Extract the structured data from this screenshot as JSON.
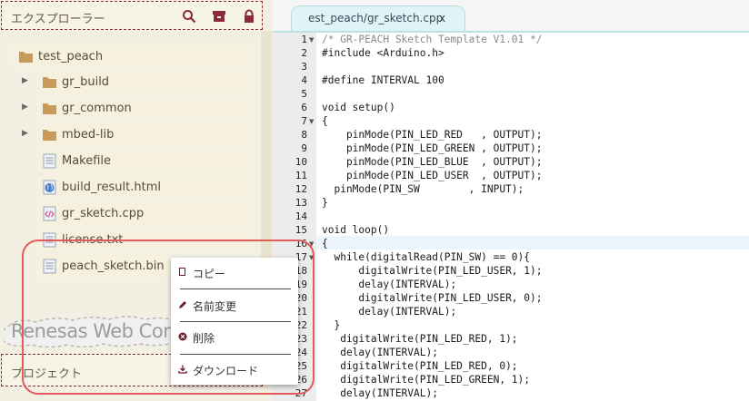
{
  "explorer": {
    "title": "エクスプローラー",
    "project_title": "プロジェクト",
    "watermark": "Renesas Web Com",
    "root": "test_peach",
    "items": [
      {
        "label": "gr_build",
        "type": "folder",
        "expandable": true
      },
      {
        "label": "gr_common",
        "type": "folder",
        "expandable": true
      },
      {
        "label": "mbed-lib",
        "type": "folder",
        "expandable": true
      },
      {
        "label": "Makefile",
        "type": "file"
      },
      {
        "label": "build_result.html",
        "type": "html"
      },
      {
        "label": "gr_sketch.cpp",
        "type": "code"
      },
      {
        "label": "license.txt",
        "type": "file"
      },
      {
        "label": "peach_sketch.bin",
        "type": "file"
      }
    ]
  },
  "context_menu": {
    "items": [
      {
        "label": "コピー",
        "icon": "copy-icon"
      },
      {
        "label": "名前変更",
        "icon": "pencil-icon"
      },
      {
        "label": "削除",
        "icon": "delete-icon"
      },
      {
        "label": "ダウンロード",
        "icon": "download-icon"
      }
    ]
  },
  "editor": {
    "tab_label": "est_peach/gr_sketch.cpp",
    "tab_close": "x",
    "lines": [
      "/* GR-PEACH Sketch Template V1.01 */",
      "#include <Arduino.h>",
      "",
      "#define INTERVAL 100",
      "",
      "void setup()",
      "{",
      "    pinMode(PIN_LED_RED   , OUTPUT);",
      "    pinMode(PIN_LED_GREEN , OUTPUT);",
      "    pinMode(PIN_LED_BLUE  , OUTPUT);",
      "    pinMode(PIN_LED_USER  , OUTPUT);",
      "  pinMode(PIN_SW        , INPUT);",
      "}",
      "",
      "void loop()",
      "{",
      "  while(digitalRead(PIN_SW) == 0){",
      "      digitalWrite(PIN_LED_USER, 1);",
      "      delay(INTERVAL);",
      "      digitalWrite(PIN_LED_USER, 0);",
      "      delay(INTERVAL);",
      "  }",
      "   digitalWrite(PIN_LED_RED, 1);",
      "   delay(INTERVAL);",
      "   digitalWrite(PIN_LED_RED, 0);",
      "   digitalWrite(PIN_LED_GREEN, 1);",
      "   delay(INTERVAL);"
    ],
    "line_numbers": [
      "1",
      "2",
      "3",
      "4",
      "5",
      "6",
      "7",
      "8",
      "9",
      "10",
      "11",
      "12",
      "13",
      "14",
      "15",
      "16",
      "17",
      "18",
      "19",
      "20",
      "21",
      "22",
      "23",
      "24",
      "25",
      "26",
      "27"
    ],
    "fold_lines": [
      1,
      7,
      16,
      17
    ]
  }
}
